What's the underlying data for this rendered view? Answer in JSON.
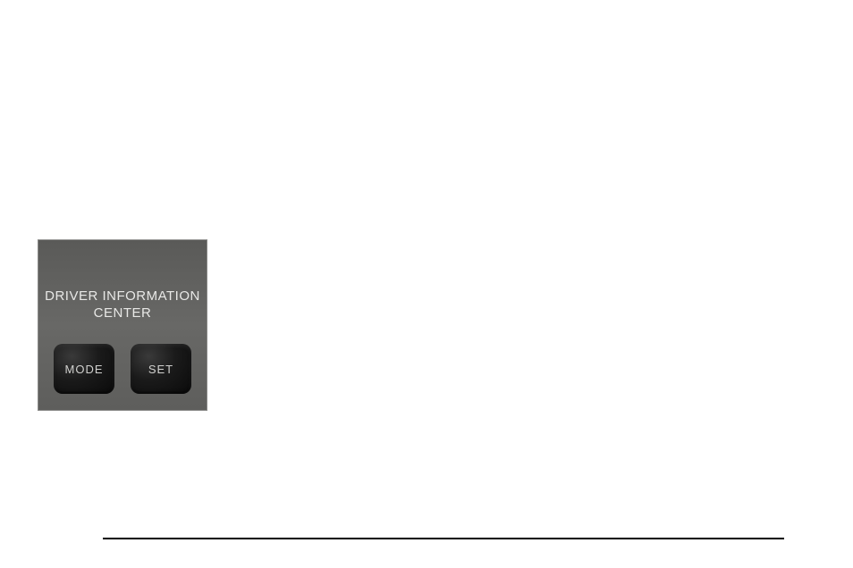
{
  "panel": {
    "title_line1": "DRIVER INFORMATION",
    "title_line2": "CENTER",
    "mode_label": "MODE",
    "set_label": "SET"
  }
}
